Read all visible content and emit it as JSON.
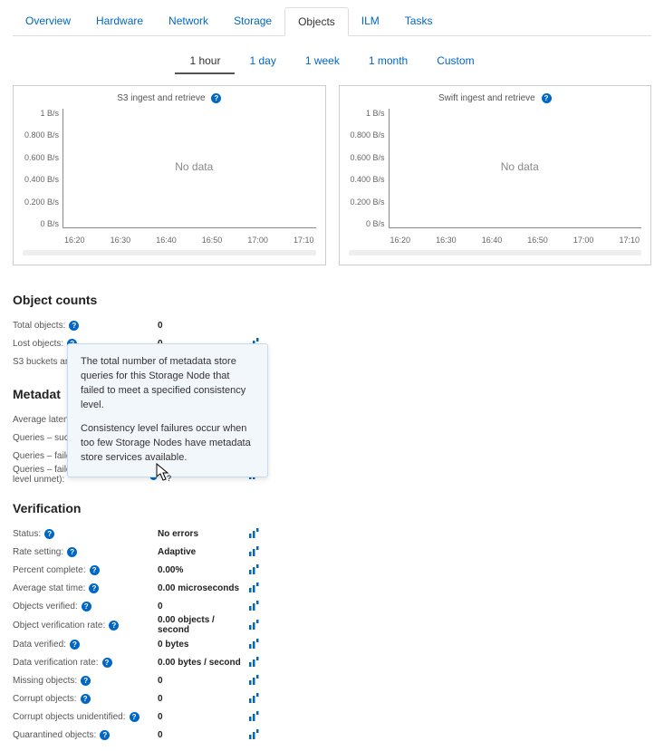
{
  "tabs": [
    "Overview",
    "Hardware",
    "Network",
    "Storage",
    "Objects",
    "ILM",
    "Tasks"
  ],
  "active_tab": "Objects",
  "timeranges": [
    "1 hour",
    "1 day",
    "1 week",
    "1 month",
    "Custom"
  ],
  "active_timerange": "1 hour",
  "charts": {
    "left": {
      "title": "S3 ingest and retrieve",
      "nodata": "No data"
    },
    "right": {
      "title": "Swift ingest and retrieve",
      "nodata": "No data"
    }
  },
  "chart_data": [
    {
      "type": "line",
      "title": "S3 ingest and retrieve",
      "x_ticks": [
        "16:20",
        "16:30",
        "16:40",
        "16:50",
        "17:00",
        "17:10"
      ],
      "y_ticks": [
        "1 B/s",
        "0.800 B/s",
        "0.600 B/s",
        "0.400 B/s",
        "0.200 B/s",
        "0 B/s"
      ],
      "ylim": [
        0,
        1
      ],
      "y_unit": "B/s",
      "series": [],
      "no_data": true
    },
    {
      "type": "line",
      "title": "Swift ingest and retrieve",
      "x_ticks": [
        "16:20",
        "16:30",
        "16:40",
        "16:50",
        "17:00",
        "17:10"
      ],
      "y_ticks": [
        "1 B/s",
        "0.800 B/s",
        "0.600 B/s",
        "0.400 B/s",
        "0.200 B/s",
        "0 B/s"
      ],
      "ylim": [
        0,
        1
      ],
      "y_unit": "B/s",
      "series": [],
      "no_data": true
    }
  ],
  "sections": {
    "object_counts": {
      "title": "Object counts",
      "rows": [
        {
          "label": "Total objects:",
          "value": "0",
          "chart": false
        },
        {
          "label": "Lost objects:",
          "value": "0",
          "chart": true
        },
        {
          "label": "S3 buckets an",
          "value": "",
          "chart": false
        }
      ]
    },
    "metadata": {
      "title": "Metadat",
      "rows": [
        {
          "label": "Average laten",
          "value": "",
          "chart": false
        },
        {
          "label": "Queries – succ",
          "value": "",
          "chart": false
        },
        {
          "label": "Queries – faile",
          "value": "",
          "chart": false
        },
        {
          "label": "Queries – failed (consistency level unmet):",
          "value": "0",
          "chart": true
        }
      ]
    },
    "verification": {
      "title": "Verification",
      "rows": [
        {
          "label": "Status:",
          "value": "No errors",
          "chart": true
        },
        {
          "label": "Rate setting:",
          "value": "Adaptive",
          "chart": true
        },
        {
          "label": "Percent complete:",
          "value": "0.00%",
          "chart": true
        },
        {
          "label": "Average stat time:",
          "value": "0.00 microseconds",
          "chart": true
        },
        {
          "label": "Objects verified:",
          "value": "0",
          "chart": true
        },
        {
          "label": "Object verification rate:",
          "value": "0.00 objects / second",
          "chart": true
        },
        {
          "label": "Data verified:",
          "value": "0 bytes",
          "chart": true
        },
        {
          "label": "Data verification rate:",
          "value": "0.00 bytes / second",
          "chart": true
        },
        {
          "label": "Missing objects:",
          "value": "0",
          "chart": true
        },
        {
          "label": "Corrupt objects:",
          "value": "0",
          "chart": true
        },
        {
          "label": "Corrupt objects unidentified:",
          "value": "0",
          "chart": true
        },
        {
          "label": "Quarantined objects:",
          "value": "0",
          "chart": true
        }
      ]
    }
  },
  "tooltip": {
    "p1": "The total number of metadata store queries for this Storage Node that failed to meet a specified consistency level.",
    "p2": "Consistency level failures occur when too few Storage Nodes have metadata store services available."
  }
}
